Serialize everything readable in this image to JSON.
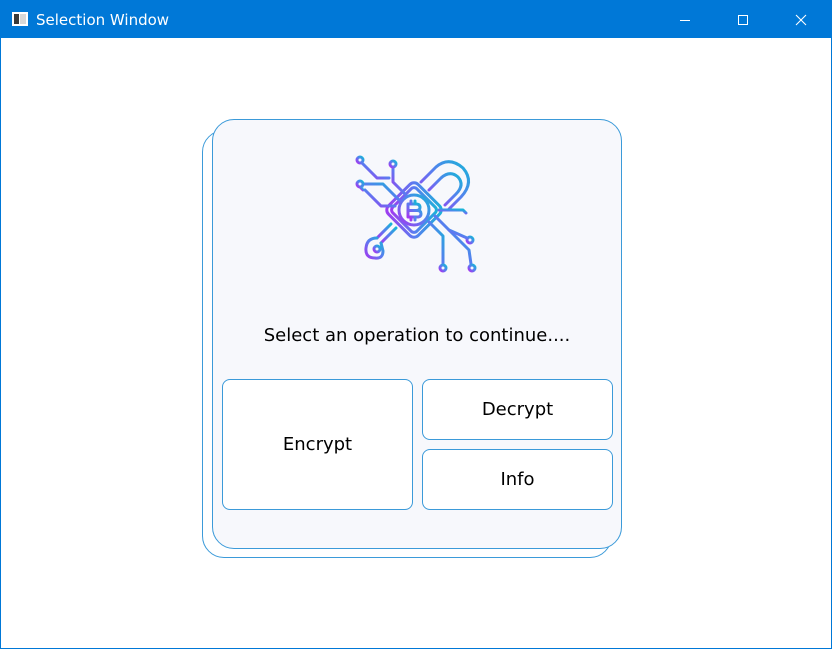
{
  "window": {
    "title": "Selection Window",
    "titlebar_color": "#0078d7",
    "controls": {
      "minimize_icon": "minimize-icon",
      "maximize_icon": "maximize-icon",
      "close_icon": "close-icon"
    }
  },
  "panel": {
    "logo_icon": "bitcoin-lock-circuit-icon",
    "prompt": "Select an operation to continue....",
    "border_color": "#3b9ad9",
    "background_color": "#f7f8fc"
  },
  "actions": {
    "encrypt_label": "Encrypt",
    "decrypt_label": "Decrypt",
    "info_label": "Info"
  }
}
